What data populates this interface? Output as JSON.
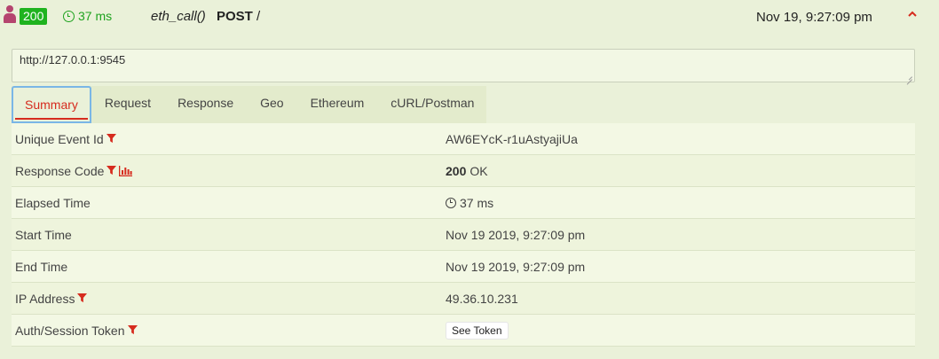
{
  "header": {
    "status_code": "200",
    "elapsed": "37 ms",
    "method_name": "eth_call()",
    "http_method": "POST",
    "path": "/",
    "timestamp": "Nov 19, 9:27:09 pm"
  },
  "url_field": {
    "value": "http://127.0.0.1:9545"
  },
  "tabs": [
    {
      "label": "Summary",
      "active": true
    },
    {
      "label": "Request"
    },
    {
      "label": "Response"
    },
    {
      "label": "Geo"
    },
    {
      "label": "Ethereum"
    },
    {
      "label": "cURL/Postman"
    }
  ],
  "summary": {
    "unique_event_id": {
      "label": "Unique Event Id",
      "value": "AW6EYcK-r1uAstyajiUa"
    },
    "response_code": {
      "label": "Response Code",
      "code": "200",
      "text": "OK"
    },
    "elapsed_time": {
      "label": "Elapsed Time",
      "value": "37 ms"
    },
    "start_time": {
      "label": "Start Time",
      "value": "Nov 19 2019, 9:27:09 pm"
    },
    "end_time": {
      "label": "End Time",
      "value": "Nov 19 2019, 9:27:09 pm"
    },
    "ip_address": {
      "label": "IP Address",
      "value": "49.36.10.231"
    },
    "auth_token": {
      "label": "Auth/Session Token",
      "button": "See Token"
    }
  },
  "colors": {
    "accent_red": "#d62b1e",
    "status_green": "#1fb31f",
    "user_icon": "#b5456f",
    "background": "#eaf1d9"
  }
}
